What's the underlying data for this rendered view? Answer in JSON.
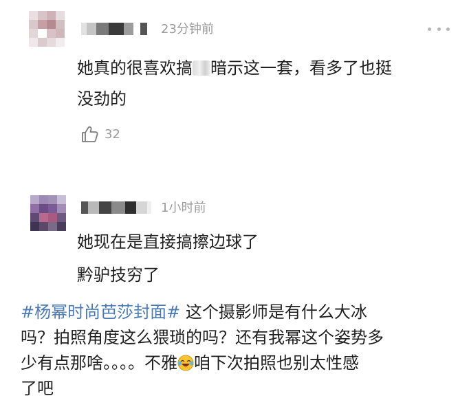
{
  "comments": [
    {
      "time": "23分钟前",
      "lines": [
        "她真的很喜欢搞",
        "暗示这一套，看多了也挺",
        "没劲的"
      ],
      "likes": "32"
    },
    {
      "time": "1小时前",
      "lines": [
        "她现在是直接搞擦边球了",
        "黔驴技穷了"
      ]
    }
  ],
  "post": {
    "hashtag": "#杨幂时尚芭莎封面#",
    "line1_rest": " 这个摄影师是有什么大冰",
    "line2": "吗？拍照角度这么猥琐的吗？还有我幂这个姿势多",
    "line3_a": "少有点那啥。。。。不雅",
    "line3_b": "咱下次拍照也别太性感",
    "line4": "了吧"
  },
  "icons": {
    "more": "more-dots-icon",
    "like": "thumbs-up-icon",
    "emoji": "crying-laughing-emoji-icon"
  },
  "colors": {
    "hashtag": "#4a7ab5",
    "meta_text": "#9a9a9a",
    "body_text": "#1f1f1f"
  }
}
